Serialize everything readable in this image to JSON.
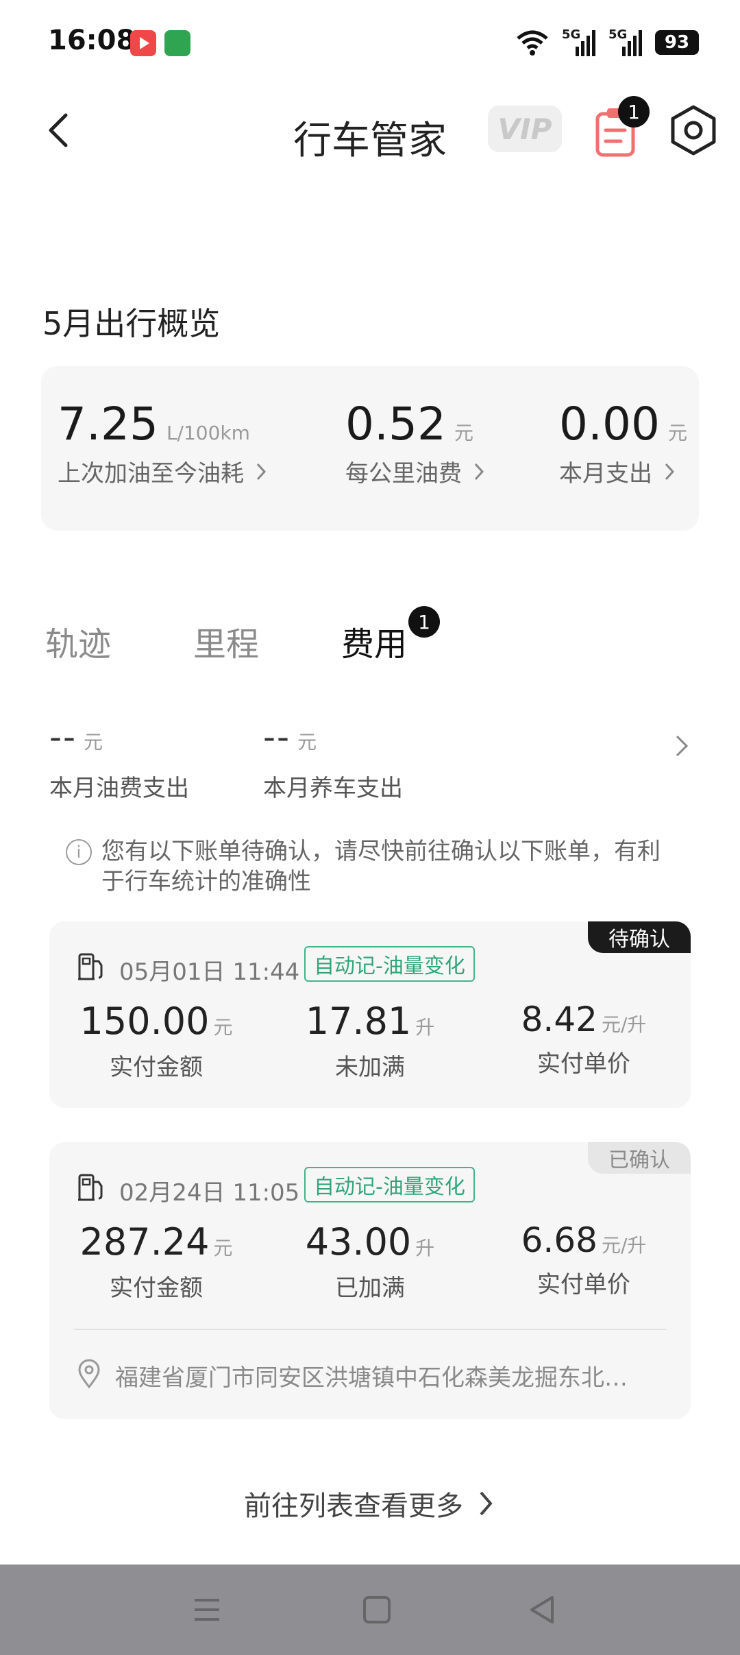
{
  "status_bar": {
    "time": "16:08",
    "network_1": "5G",
    "network_2": "5G",
    "battery": "93"
  },
  "header": {
    "title": "行车管家",
    "vip_label": "VIP",
    "notification_count": "1"
  },
  "overview": {
    "title": "5月出行概览",
    "items": [
      {
        "value": "7.25",
        "unit": "L/100km",
        "label": "上次加油至今油耗"
      },
      {
        "value": "0.52",
        "unit": "元",
        "label": "每公里油费"
      },
      {
        "value": "0.00",
        "unit": "元",
        "label": "本月支出"
      }
    ]
  },
  "tabs": [
    {
      "label": "轨迹",
      "active": false
    },
    {
      "label": "里程",
      "active": false
    },
    {
      "label": "费用",
      "active": true,
      "badge": "1"
    }
  ],
  "expense_summary": {
    "items": [
      {
        "value": "--",
        "unit": "元",
        "label": "本月油费支出"
      },
      {
        "value": "--",
        "unit": "元",
        "label": "本月养车支出"
      }
    ]
  },
  "notice": {
    "icon": "info-icon",
    "icon_glyph": "i",
    "text": "您有以下账单待确认，请尽快前往确认以下账单，有利于行车统计的准确性"
  },
  "bills": [
    {
      "status": "待确认",
      "datetime": "05月01日 11:44",
      "tag": "自动记-油量变化",
      "amount": {
        "value": "150.00",
        "unit": "元",
        "label": "实付金额"
      },
      "volume": {
        "value": "17.81",
        "unit": "升",
        "label": "未加满"
      },
      "price": {
        "value": "8.42",
        "unit": "元/升",
        "label": "实付单价"
      }
    },
    {
      "status": "已确认",
      "datetime": "02月24日 11:05",
      "tag": "自动记-油量变化",
      "amount": {
        "value": "287.24",
        "unit": "元",
        "label": "实付金额"
      },
      "volume": {
        "value": "43.00",
        "unit": "升",
        "label": "已加满"
      },
      "price": {
        "value": "6.68",
        "unit": "元/升",
        "label": "实付单价"
      },
      "location": "福建省厦门市同安区洪塘镇中石化森美龙掘东北…"
    }
  ],
  "more_link": "前往列表查看更多",
  "colors": {
    "accent_green": "#2fa57a",
    "badge_dark": "#111111",
    "card_bg": "#f6f6f6",
    "nav_bar": "#8e8e93"
  }
}
